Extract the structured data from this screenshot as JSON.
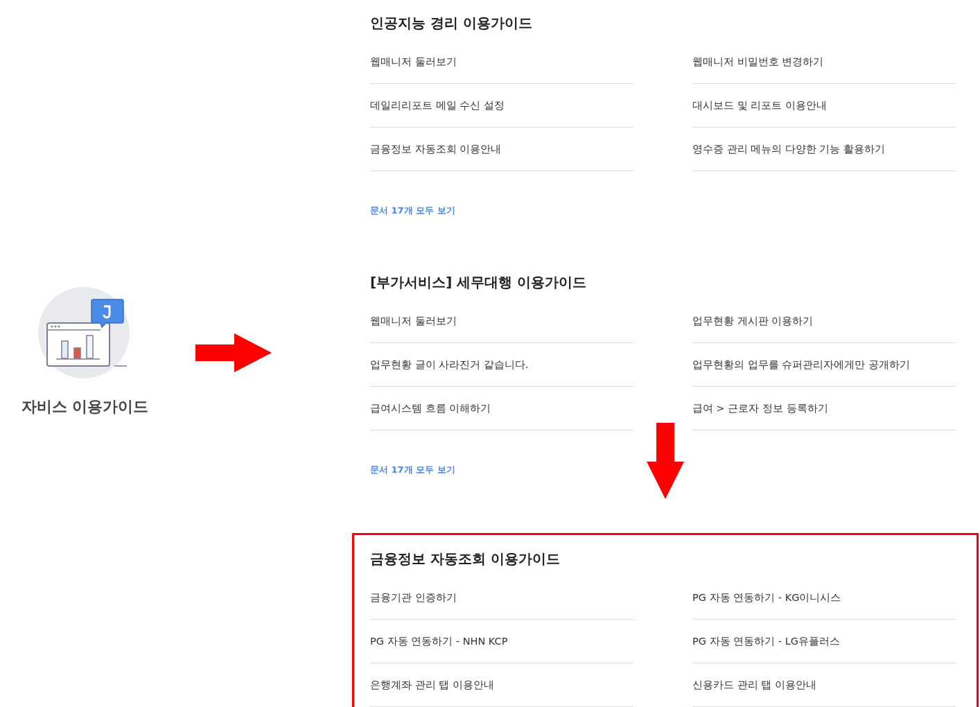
{
  "service_label": "자비스 이용가이드",
  "sections": [
    {
      "title": "인공지능 경리 이용가이드",
      "highlighted": false,
      "items": [
        "웹매니저 둘러보기",
        "웹매니저 비밀번호 변경하기",
        "데일리리포트 메일 수신 설정",
        "대시보드 및 리포트 이용안내",
        "금융정보 자동조회 이용안내",
        "영수증 관리 메뉴의 다양한 기능 활용하기"
      ],
      "link": "문서 17개 모두 보기"
    },
    {
      "title": "[부가서비스] 세무대행 이용가이드",
      "highlighted": false,
      "items": [
        "웹매니저 둘러보기",
        "업무현황 게시판 이용하기",
        "업무현황 글이 사라진거 같습니다.",
        "업무현황의 업무를 슈퍼관리자에게만 공개하기",
        "급여시스템 흐름 이해하기",
        "급여 > 근로자 정보 등록하기"
      ],
      "link": "문서 17개 모두 보기"
    },
    {
      "title": "금융정보 자동조회 이용가이드",
      "highlighted": true,
      "items": [
        "금융기관 인증하기",
        "PG 자동 연동하기 - KG이니시스",
        "PG 자동 연동하기 - NHN KCP",
        "PG 자동 연동하기 - LG유플러스",
        "은행계좌 관리 탭 이용안내",
        "신용카드 관리 탭 이용안내"
      ]
    }
  ]
}
